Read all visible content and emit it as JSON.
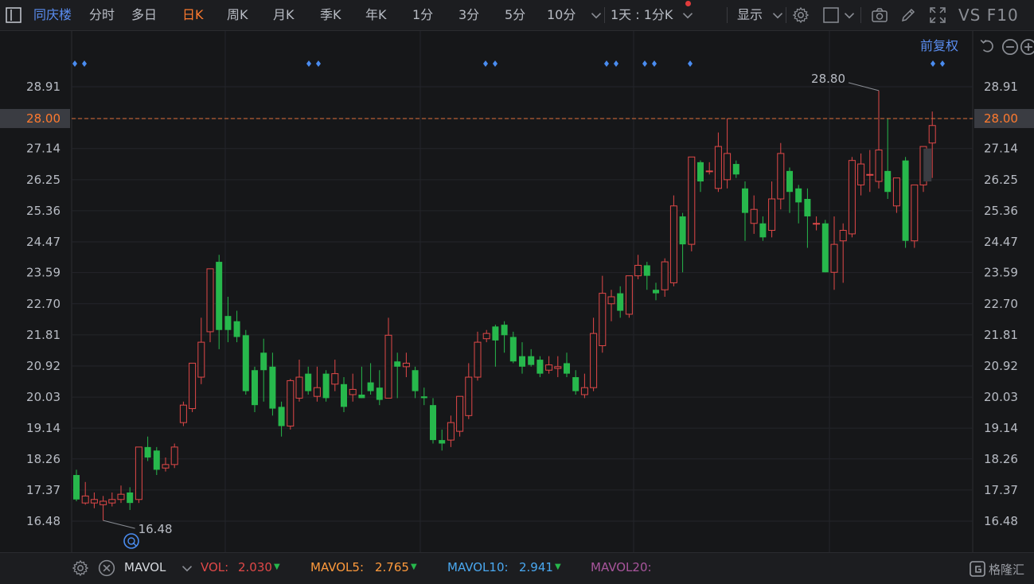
{
  "header": {
    "stock_name": "同庆楼",
    "periods": [
      {
        "label": "分时",
        "active": false
      },
      {
        "label": "多日",
        "active": false
      },
      {
        "label": "日K",
        "active": true
      },
      {
        "label": "周K",
        "active": false
      },
      {
        "label": "月K",
        "active": false
      },
      {
        "label": "季K",
        "active": false
      },
      {
        "label": "年K",
        "active": false
      },
      {
        "label": "1分",
        "active": false
      },
      {
        "label": "3分",
        "active": false
      },
      {
        "label": "5分",
        "active": false
      },
      {
        "label": "10分",
        "active": false
      }
    ],
    "combo_label": "1天 : 1分K",
    "display_label": "显示",
    "brand_text": "VS F10"
  },
  "chart": {
    "adjust_label": "前复权",
    "current_price_label": "28.00",
    "max_label": "28.80",
    "min_label": "16.48"
  },
  "chart_data": {
    "type": "candlestick",
    "y_ticks": [
      "28.91",
      "28.00",
      "27.14",
      "26.25",
      "25.36",
      "24.47",
      "23.59",
      "22.70",
      "21.81",
      "20.92",
      "20.03",
      "19.14",
      "18.26",
      "17.37",
      "16.48"
    ],
    "ylim": [
      16.48,
      28.91
    ],
    "current_price": 28.0,
    "high_marker": 28.8,
    "low_marker": 16.48,
    "candles": [
      [
        17.8,
        17.1,
        17.95,
        17.05
      ],
      [
        17.0,
        17.2,
        17.6,
        16.95
      ],
      [
        17.0,
        17.1,
        17.3,
        16.85
      ],
      [
        16.95,
        17.05,
        17.2,
        16.5
      ],
      [
        17.0,
        17.1,
        17.3,
        16.9
      ],
      [
        17.1,
        17.25,
        17.5,
        17.0
      ],
      [
        17.3,
        17.0,
        17.45,
        16.8
      ],
      [
        17.1,
        18.6,
        18.6,
        17.0
      ],
      [
        18.6,
        18.3,
        18.9,
        18.2
      ],
      [
        18.5,
        17.95,
        18.6,
        17.8
      ],
      [
        18.0,
        18.1,
        18.3,
        17.9
      ],
      [
        18.1,
        18.6,
        18.7,
        18.0
      ],
      [
        19.3,
        19.8,
        19.9,
        19.2
      ],
      [
        19.7,
        21.0,
        21.0,
        19.6
      ],
      [
        20.6,
        21.6,
        22.3,
        20.4
      ],
      [
        21.9,
        23.7,
        23.7,
        21.6
      ],
      [
        23.9,
        21.95,
        24.1,
        21.4
      ],
      [
        22.35,
        21.95,
        22.9,
        21.6
      ],
      [
        22.2,
        21.75,
        22.5,
        21.6
      ],
      [
        21.8,
        20.2,
        21.95,
        20.1
      ],
      [
        20.8,
        19.8,
        20.9,
        19.6
      ],
      [
        21.3,
        20.8,
        21.7,
        19.9
      ],
      [
        20.9,
        19.7,
        21.3,
        19.5
      ],
      [
        19.75,
        19.2,
        19.9,
        18.9
      ],
      [
        19.2,
        20.5,
        20.55,
        19.1
      ],
      [
        20.0,
        20.6,
        21.1,
        19.9
      ],
      [
        20.7,
        20.2,
        20.9,
        20.1
      ],
      [
        20.05,
        20.3,
        20.9,
        19.9
      ],
      [
        20.7,
        20.0,
        20.8,
        19.9
      ],
      [
        20.4,
        20.7,
        21.1,
        20.2
      ],
      [
        20.4,
        19.75,
        20.6,
        19.6
      ],
      [
        20.1,
        20.25,
        20.7,
        19.9
      ],
      [
        20.1,
        20.0,
        20.9,
        20.0
      ],
      [
        20.45,
        20.2,
        21.0,
        20.1
      ],
      [
        20.3,
        19.95,
        20.8,
        19.8
      ],
      [
        20.0,
        21.8,
        22.3,
        20.0
      ],
      [
        21.05,
        20.9,
        21.3,
        20.0
      ],
      [
        20.9,
        21.0,
        21.3,
        20.6
      ],
      [
        20.8,
        20.2,
        20.9,
        20.0
      ],
      [
        20.05,
        20.0,
        20.3,
        19.8
      ],
      [
        19.8,
        18.8,
        20.0,
        18.7
      ],
      [
        18.8,
        18.7,
        19.1,
        18.5
      ],
      [
        18.8,
        19.3,
        19.5,
        18.6
      ],
      [
        19.05,
        20.05,
        20.0,
        18.9
      ],
      [
        19.5,
        20.6,
        21.0,
        19.4
      ],
      [
        20.6,
        21.6,
        21.9,
        20.5
      ],
      [
        21.7,
        21.85,
        21.95,
        21.6
      ],
      [
        22.05,
        21.65,
        22.1,
        20.9
      ],
      [
        22.1,
        21.8,
        22.2,
        21.3
      ],
      [
        21.75,
        21.05,
        21.9,
        21.0
      ],
      [
        21.2,
        20.9,
        21.6,
        20.7
      ],
      [
        21.2,
        20.95,
        21.4,
        20.9
      ],
      [
        21.1,
        20.7,
        21.2,
        20.6
      ],
      [
        20.8,
        20.95,
        21.2,
        20.7
      ],
      [
        20.85,
        20.9,
        21.2,
        20.6
      ],
      [
        21.0,
        20.7,
        21.3,
        20.6
      ],
      [
        20.6,
        20.2,
        20.8,
        20.1
      ],
      [
        20.1,
        20.3,
        20.7,
        20.0
      ],
      [
        20.3,
        21.85,
        22.3,
        20.2
      ],
      [
        21.5,
        23.0,
        23.5,
        21.3
      ],
      [
        22.7,
        22.9,
        23.1,
        22.2
      ],
      [
        23.0,
        22.5,
        23.2,
        22.3
      ],
      [
        22.4,
        23.5,
        23.5,
        22.3
      ],
      [
        23.5,
        23.8,
        24.1,
        23.4
      ],
      [
        23.8,
        23.5,
        23.9,
        23.1
      ],
      [
        23.1,
        23.0,
        23.3,
        22.8
      ],
      [
        23.1,
        23.9,
        24.0,
        22.9
      ],
      [
        23.3,
        25.5,
        25.8,
        23.2
      ],
      [
        25.2,
        24.4,
        25.3,
        23.6
      ],
      [
        24.4,
        26.9,
        26.9,
        24.2
      ],
      [
        26.75,
        26.2,
        26.8,
        25.9
      ],
      [
        26.5,
        26.5,
        26.75,
        26.4
      ],
      [
        26.0,
        27.2,
        27.6,
        25.9
      ],
      [
        26.25,
        27.0,
        28.0,
        26.0
      ],
      [
        26.7,
        26.4,
        26.8,
        26.3
      ],
      [
        26.0,
        25.3,
        26.2,
        24.5
      ],
      [
        25.0,
        25.4,
        25.8,
        24.7
      ],
      [
        25.0,
        24.6,
        25.2,
        24.5
      ],
      [
        24.8,
        25.7,
        26.2,
        24.6
      ],
      [
        25.7,
        27.0,
        27.3,
        25.4
      ],
      [
        26.5,
        25.9,
        26.6,
        25.3
      ],
      [
        26.0,
        25.6,
        26.1,
        25.0
      ],
      [
        25.7,
        25.2,
        26.0,
        24.3
      ],
      [
        25.0,
        25.0,
        25.2,
        24.8
      ],
      [
        25.0,
        23.6,
        25.1,
        23.6
      ],
      [
        23.6,
        24.4,
        25.2,
        23.1
      ],
      [
        24.5,
        24.8,
        25.0,
        23.3
      ],
      [
        24.7,
        26.8,
        26.9,
        24.6
      ],
      [
        26.1,
        26.7,
        27.0,
        25.8
      ],
      [
        26.4,
        26.4,
        27.1,
        25.9
      ],
      [
        26.2,
        27.1,
        28.8,
        26.0
      ],
      [
        26.5,
        25.9,
        28.0,
        25.7
      ],
      [
        25.5,
        26.3,
        26.3,
        25.3
      ],
      [
        26.8,
        24.5,
        26.9,
        24.3
      ],
      [
        24.5,
        26.1,
        26.1,
        24.3
      ],
      [
        26.1,
        27.2,
        27.2,
        25.9
      ],
      [
        27.3,
        27.8,
        28.2,
        26.3
      ]
    ]
  },
  "volume_bar": {
    "indicator": "MAVOL",
    "vol_label": "VOL:",
    "vol_value": "2.030",
    "ma5_label": "MAVOL5:",
    "ma5_value": "2.765",
    "ma10_label": "MAVOL10:",
    "ma10_value": "2.941",
    "ma20_label": "MAVOL20:"
  },
  "watermark": {
    "text": "格隆汇"
  },
  "colors": {
    "up": "#e04848",
    "down": "#27b84c",
    "accent": "#ff7a2e",
    "blue": "#5a8df0",
    "ma20": "#a8559c"
  }
}
